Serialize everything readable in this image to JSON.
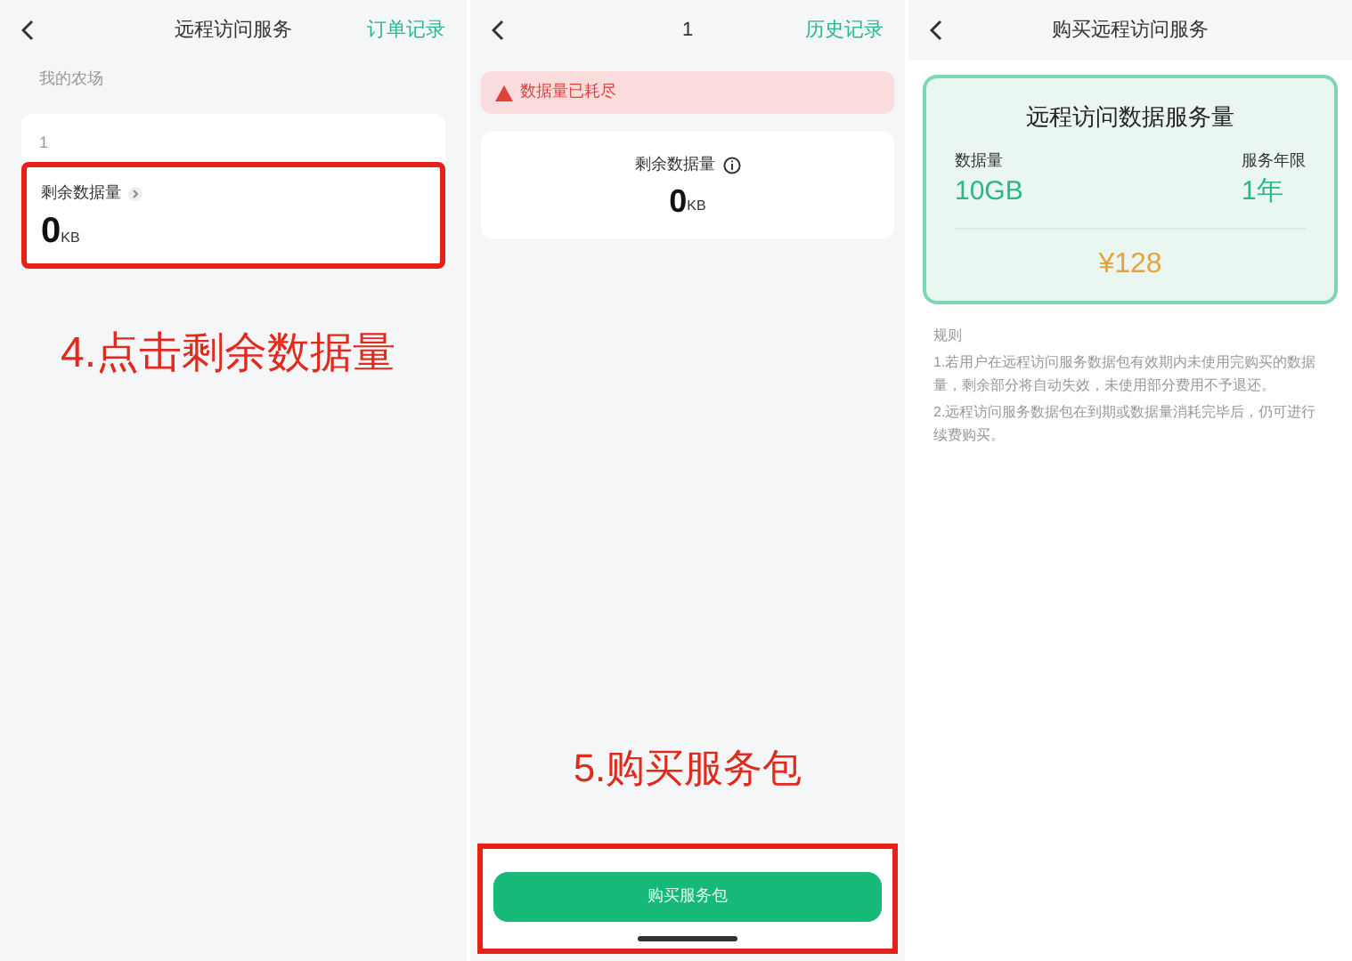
{
  "panels": [
    {
      "kind": "overview",
      "title": "远程访问服务",
      "action": "订单记录",
      "section_label": "我的农场",
      "farm_name": "1",
      "data_label": "剩余数据量",
      "data_value": "0",
      "data_unit": "KB",
      "highlighted": true,
      "annotation": "4.点击剩余数据量"
    },
    {
      "kind": "detail",
      "title": "1",
      "action": "历史记录",
      "alert": "数据量已耗尽",
      "data_label": "剩余数据量",
      "data_value": "0",
      "data_unit": "KB",
      "annotation": "5.购买服务包",
      "button": "购买服务包",
      "highlighted": true
    },
    {
      "kind": "purchase",
      "title": "购买远程访问服务",
      "package": {
        "title": "远程访问数据服务量",
        "selected": true,
        "amount_label": "数据量",
        "amount": "10GB",
        "term_label": "服务年限",
        "term": "1年",
        "price": "¥128"
      },
      "rules_title": "规则",
      "rules": [
        "1.若用户在远程访问服务数据包有效期内未使用完购买的数据量，剩余部分将自动失效，未使用部分费用不予退还。",
        "2.远程访问服务数据包在到期或数据量消耗完毕后，仍可进行续费购买。"
      ]
    }
  ]
}
